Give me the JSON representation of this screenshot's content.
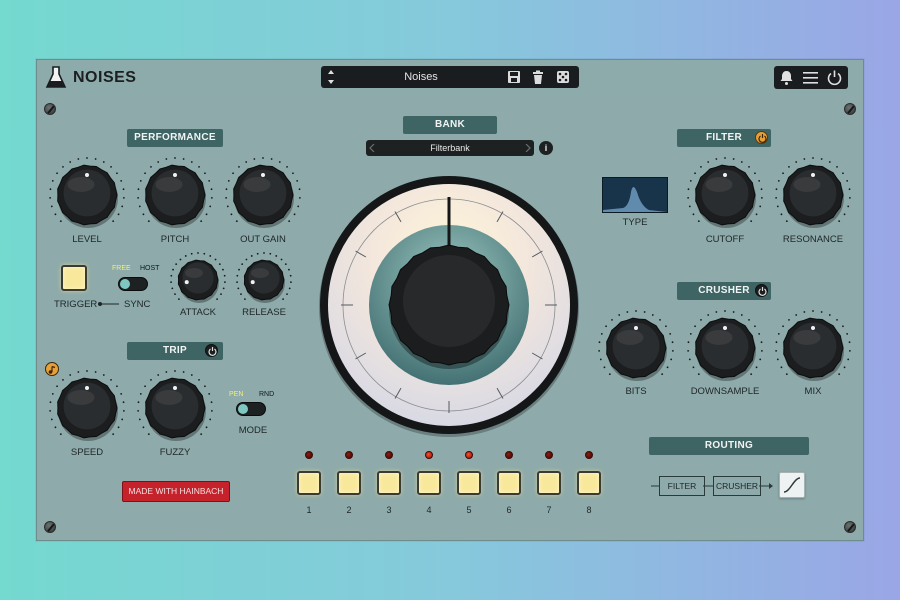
{
  "app": {
    "title": "NOISES"
  },
  "preset": {
    "name": "Noises"
  },
  "sections": {
    "performance": "PERFORMANCE",
    "trip": "TRIP",
    "bank": "BANK",
    "filter": "FILTER",
    "crusher": "CRUSHER",
    "routing": "ROUTING"
  },
  "performance": {
    "knobs": [
      "LEVEL",
      "PITCH",
      "OUT GAIN"
    ],
    "trigger_label": "TRIGGER",
    "sync_label": "SYNC",
    "sync_free": "FREE",
    "sync_host": "HOST",
    "attack_label": "ATTACK",
    "release_label": "RELEASE"
  },
  "trip": {
    "speed_label": "SPEED",
    "fuzzy_label": "FUZZY",
    "mode_label": "MODE",
    "mode_pen": "PEN",
    "mode_rnd": "RND"
  },
  "bank": {
    "selected": "Filterbank",
    "info": "i"
  },
  "filter": {
    "type_label": "TYPE",
    "cutoff_label": "CUTOFF",
    "resonance_label": "RESONANCE"
  },
  "crusher": {
    "bits_label": "BITS",
    "downsample_label": "DOWNSAMPLE",
    "mix_label": "MIX"
  },
  "routing": {
    "first": "FILTER",
    "second": "CRUSHER"
  },
  "pads": [
    "1",
    "2",
    "3",
    "4",
    "5",
    "6",
    "7",
    "8"
  ],
  "leds_on": [
    false,
    false,
    false,
    true,
    true,
    false,
    false,
    false
  ],
  "made_with": "MADE WITH HAINBACH",
  "colors": {
    "panel": "#8eaaaa",
    "section_title": "#3f6464",
    "pad": "#f8e89c",
    "accent_red": "#c5222b",
    "power_orange": "#e6a03a"
  }
}
